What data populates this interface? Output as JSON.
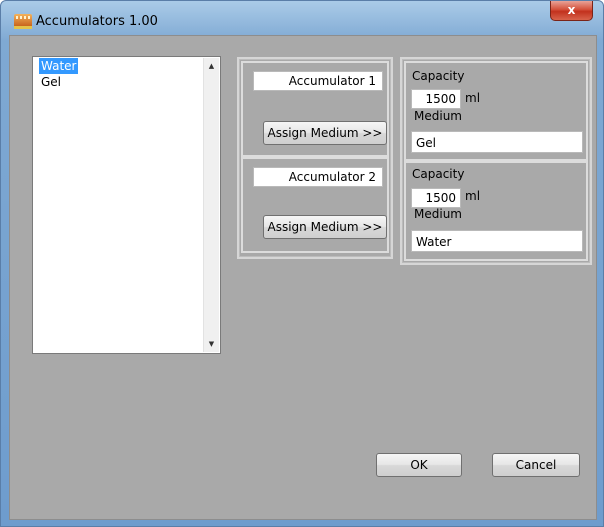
{
  "window": {
    "title": "Accumulators  1.00",
    "close_label": "x"
  },
  "media_list": {
    "items": [
      "Water",
      "Gel"
    ],
    "selected_index": 0
  },
  "accumulators": [
    {
      "name": "Accumulator 1",
      "assign_label": "Assign Medium >>",
      "capacity_label": "Capacity",
      "capacity_value": "1500",
      "unit": "ml",
      "medium_label": "Medium",
      "medium_value": "Gel"
    },
    {
      "name": "Accumulator 2",
      "assign_label": "Assign Medium >>",
      "capacity_label": "Capacity",
      "capacity_value": "1500",
      "unit": "ml",
      "medium_label": "Medium",
      "medium_value": "Water"
    }
  ],
  "buttons": {
    "ok_label": "OK",
    "cancel_label": "Cancel"
  },
  "colors": {
    "selection": "#3399ff",
    "dialog_background": "#a9a9a9",
    "close_button": "#c2311d"
  }
}
